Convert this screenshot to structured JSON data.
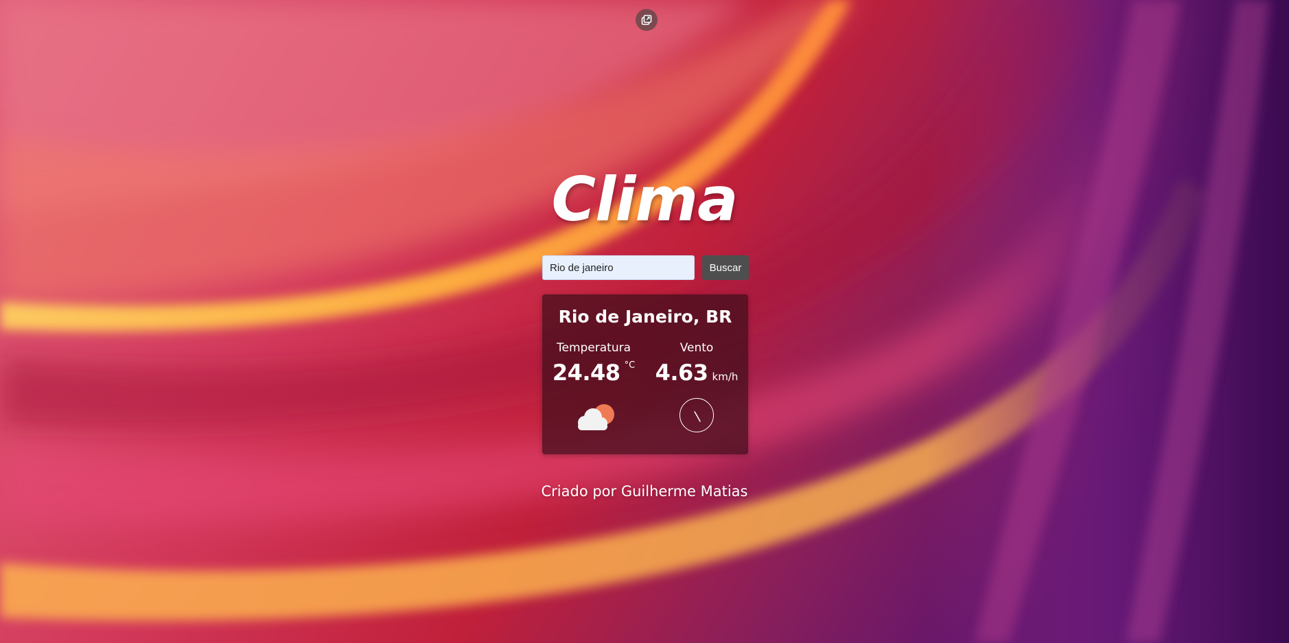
{
  "app": {
    "title": "Clima"
  },
  "search": {
    "value": "Rio de janeiro",
    "button_label": "Buscar"
  },
  "weather": {
    "city": "Rio de Janeiro, BR",
    "temperature_label": "Temperatura",
    "temperature_value": "24.48",
    "temperature_unit": "°C",
    "wind_label": "Vento",
    "wind_value": "4.63",
    "wind_unit": "km/h",
    "condition_icon": "partly-cloudy-icon",
    "wind_direction_icon": "wind-direction-compass-icon"
  },
  "footer": {
    "credit": "Criado por Guilherme Matias"
  },
  "colors": {
    "card_background": "#3e0e1a",
    "button_background": "#4e4e4e",
    "input_background": "#e8f0fe",
    "sun": "#f07a55",
    "cloud": "#f2f2f2"
  },
  "top_icon": "external-window-icon"
}
